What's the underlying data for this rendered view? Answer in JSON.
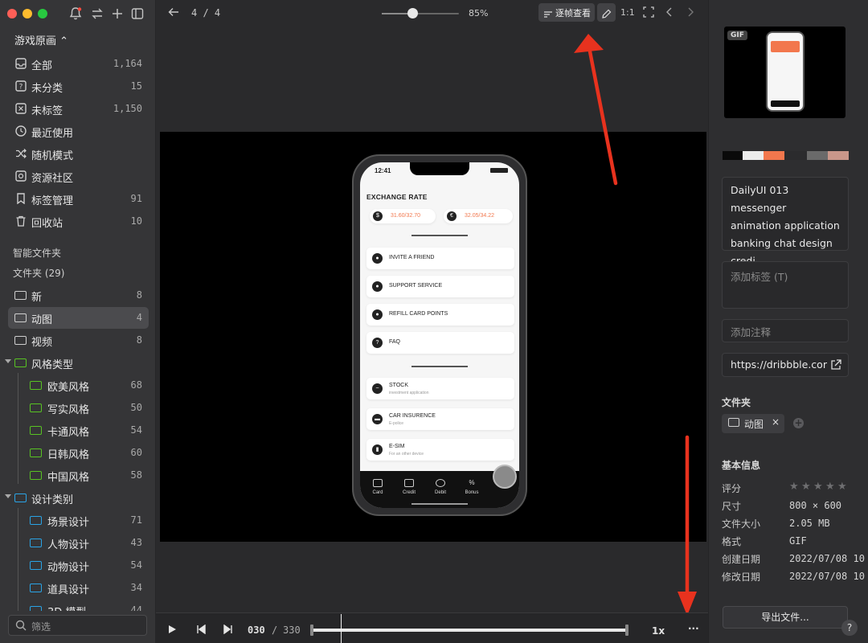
{
  "sidebar": {
    "library_title": "游戏原画 ⌃",
    "items": [
      {
        "label": "全部",
        "count": "1,164"
      },
      {
        "label": "未分类",
        "count": "15"
      },
      {
        "label": "未标签",
        "count": "1,150"
      },
      {
        "label": "最近使用",
        "count": ""
      },
      {
        "label": "随机模式",
        "count": ""
      },
      {
        "label": "资源社区",
        "count": ""
      },
      {
        "label": "标签管理",
        "count": "91"
      },
      {
        "label": "回收站",
        "count": "10"
      }
    ],
    "smart_folders_label": "智能文件夹",
    "folders_label": "文件夹 (29)",
    "folders": [
      {
        "label": "新",
        "count": "8"
      },
      {
        "label": "动图",
        "count": "4"
      },
      {
        "label": "视频",
        "count": "8"
      },
      {
        "label": "风格类型",
        "count": ""
      },
      {
        "label": "欧美风格",
        "count": "68"
      },
      {
        "label": "写实风格",
        "count": "50"
      },
      {
        "label": "卡通风格",
        "count": "54"
      },
      {
        "label": "日韩风格",
        "count": "60"
      },
      {
        "label": "中国风格",
        "count": "58"
      },
      {
        "label": "设计类别",
        "count": ""
      },
      {
        "label": "场景设计",
        "count": "71"
      },
      {
        "label": "人物设计",
        "count": "43"
      },
      {
        "label": "动物设计",
        "count": "54"
      },
      {
        "label": "道具设计",
        "count": "34"
      },
      {
        "label": "3D 模型",
        "count": "44"
      }
    ],
    "filter_placeholder": "筛选"
  },
  "toolbar": {
    "page_indicator": "4 / 4",
    "zoom_percent": "85%",
    "zoom_level": 0.4,
    "frame_view_label": "逐帧查看",
    "actual_size_label": "1:1"
  },
  "phone": {
    "time": "12:41",
    "title": "EXCHANGE RATE",
    "rate_usd": "31.60/32.70",
    "rate_eur": "32.05/34.22",
    "menu": [
      {
        "label": "INVITE A FRIEND",
        "sub": ""
      },
      {
        "label": "SUPPORT SERVICE",
        "sub": ""
      },
      {
        "label": "REFILL CARD POINTS",
        "sub": ""
      },
      {
        "label": "FAQ",
        "sub": ""
      },
      {
        "label": "STOCK",
        "sub": "investment application"
      },
      {
        "label": "CAR INSURENCE",
        "sub": "E-police"
      },
      {
        "label": "E-SIM",
        "sub": "For an other device"
      }
    ],
    "tabs": [
      "Card",
      "Credit",
      "Debit",
      "Bonus"
    ]
  },
  "player": {
    "current_frame": "030",
    "separator": "/",
    "total_frames": "330",
    "speed": "1x",
    "more": "···"
  },
  "info": {
    "gif_badge": "GIF",
    "palette": [
      "#0a0a0a",
      "#ececec",
      "#f2774d",
      "#2b2b2d",
      "#6a6a6a",
      "#c9978a"
    ],
    "title": "DailyUI 013 messenger animation application banking chat design credi",
    "tags_placeholder": "添加标签 (T)",
    "notes_placeholder": "添加注释",
    "url": "https://dribbble.cor",
    "folder_heading": "文件夹",
    "folder_chip": "动图",
    "basic_info_heading": "基本信息",
    "rows": [
      {
        "label": "评分",
        "value": ""
      },
      {
        "label": "尺寸",
        "value": "800 × 600"
      },
      {
        "label": "文件大小",
        "value": "2.05 MB"
      },
      {
        "label": "格式",
        "value": "GIF"
      },
      {
        "label": "创建日期",
        "value": "2022/07/08 10"
      },
      {
        "label": "修改日期",
        "value": "2022/07/08 10"
      }
    ],
    "rating_stars": 0,
    "export_label": "导出文件...",
    "help": "?"
  },
  "colors": {
    "accent": "#f2774d",
    "folder_green": "#58c323",
    "folder_blue": "#2aa4e6",
    "annotation_red": "#e8321e"
  }
}
